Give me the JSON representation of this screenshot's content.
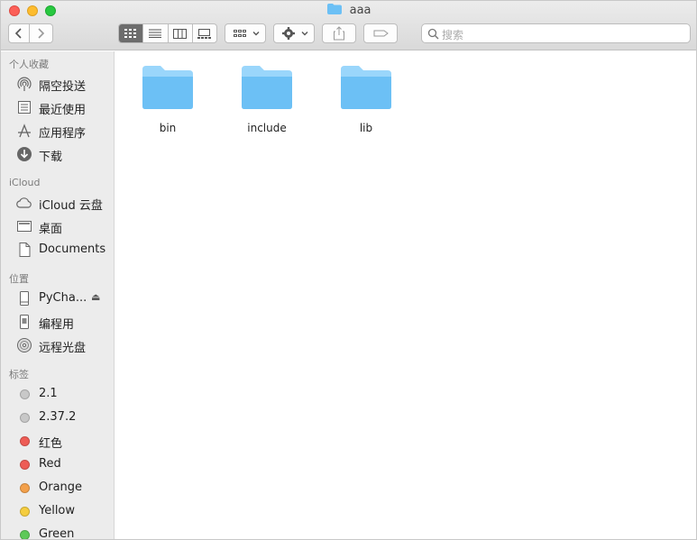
{
  "window": {
    "title": "aaa"
  },
  "toolbar": {
    "search_placeholder": "搜索"
  },
  "sidebar": {
    "sections": [
      {
        "header": "个人收藏",
        "items": [
          {
            "label": "隔空投送",
            "icon": "airdrop-icon"
          },
          {
            "label": "最近使用",
            "icon": "recents-icon"
          },
          {
            "label": "应用程序",
            "icon": "applications-icon"
          },
          {
            "label": "下载",
            "icon": "downloads-icon"
          }
        ]
      },
      {
        "header": "iCloud",
        "items": [
          {
            "label": "iCloud 云盘",
            "icon": "cloud-icon"
          },
          {
            "label": "桌面",
            "icon": "desktop-icon"
          },
          {
            "label": "Documents",
            "icon": "document-icon"
          }
        ]
      },
      {
        "header": "位置",
        "items": [
          {
            "label": "PyCha...",
            "icon": "drive-icon"
          },
          {
            "label": "编程用",
            "icon": "external-drive-icon"
          },
          {
            "label": "远程光盘",
            "icon": "disc-icon"
          }
        ]
      },
      {
        "header": "标签",
        "items": [
          {
            "label": "2.1",
            "color": "#c8c8c8"
          },
          {
            "label": "2.37.2",
            "color": "#c8c8c8"
          },
          {
            "label": "红色",
            "color": "#ee5c55"
          },
          {
            "label": "Red",
            "color": "#ee5c55"
          },
          {
            "label": "Orange",
            "color": "#f3a04a"
          },
          {
            "label": "Yellow",
            "color": "#f5cd3f"
          },
          {
            "label": "Green",
            "color": "#5dc958"
          }
        ]
      }
    ]
  },
  "files": [
    {
      "name": "bin"
    },
    {
      "name": "include"
    },
    {
      "name": "lib"
    }
  ],
  "colors": {
    "folder": "#6cc0f5",
    "folder_top": "#9ad6fb"
  }
}
